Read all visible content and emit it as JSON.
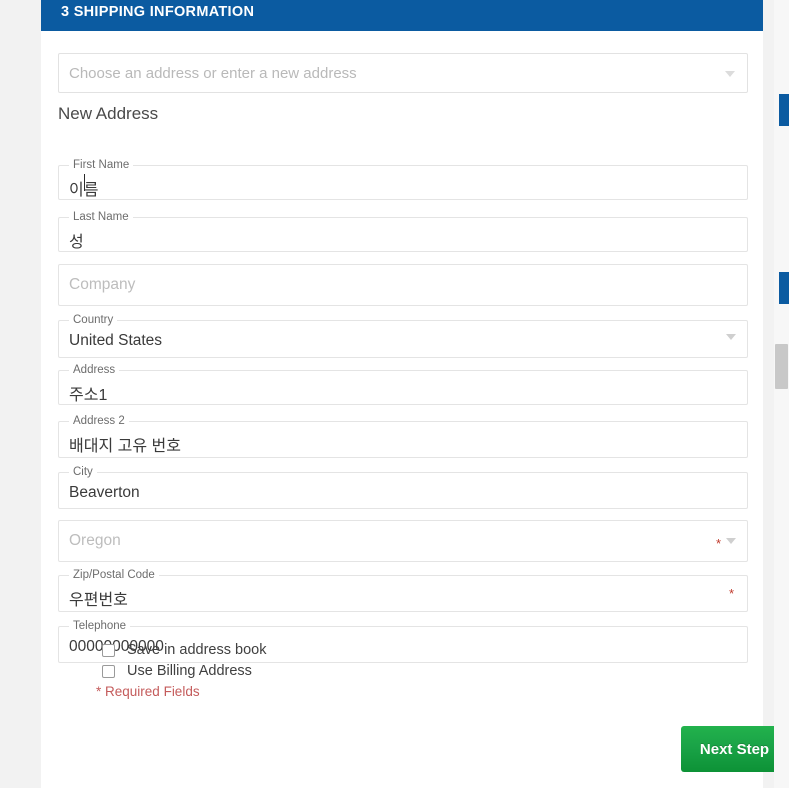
{
  "section": {
    "step_number": "3",
    "title": "3 SHIPPING INFORMATION",
    "header_color": "#0b5ba1"
  },
  "address_select": {
    "placeholder": "Choose an address or enter a new address",
    "value": "",
    "caret_icon": "chevron-down-icon"
  },
  "new_address_heading": "New Address",
  "fields": [
    {
      "name": "first-name",
      "label": "First Name",
      "value": "이름",
      "placeholder": "",
      "has_label": true,
      "required": false,
      "is_select": false,
      "korean": true
    },
    {
      "name": "last-name",
      "label": "Last Name",
      "value": "성",
      "placeholder": "",
      "has_label": true,
      "required": false,
      "is_select": false,
      "korean": true
    },
    {
      "name": "company",
      "label": "",
      "value": "",
      "placeholder": "Company",
      "has_label": false,
      "required": false,
      "is_select": false,
      "korean": false
    },
    {
      "name": "country",
      "label": "Country",
      "value": "United States",
      "placeholder": "",
      "has_label": true,
      "required": false,
      "is_select": true,
      "korean": false
    },
    {
      "name": "address",
      "label": "Address",
      "value": "주소1",
      "placeholder": "",
      "has_label": true,
      "required": false,
      "is_select": false,
      "korean": true
    },
    {
      "name": "address-2",
      "label": "Address 2",
      "value": "배대지 고유 번호",
      "placeholder": "",
      "has_label": true,
      "required": false,
      "is_select": false,
      "korean": true
    },
    {
      "name": "city",
      "label": "City",
      "value": "Beaverton",
      "placeholder": "",
      "has_label": true,
      "required": false,
      "is_select": false,
      "korean": false
    },
    {
      "name": "state",
      "label": "",
      "value": "",
      "placeholder": "Oregon",
      "has_label": false,
      "required": true,
      "is_select": true,
      "korean": false
    },
    {
      "name": "zip-postal-code",
      "label": "Zip/Postal Code",
      "value": "우편번호",
      "placeholder": "",
      "has_label": true,
      "required": true,
      "is_select": false,
      "korean": true
    },
    {
      "name": "telephone",
      "label": "Telephone",
      "value": "00000000000",
      "placeholder": "",
      "has_label": true,
      "required": false,
      "is_select": false,
      "korean": false
    }
  ],
  "checkboxes": [
    {
      "name": "save-in-address-book",
      "label": "Save in address book",
      "checked": false
    },
    {
      "name": "use-billing-address",
      "label": "Use Billing Address",
      "checked": false
    }
  ],
  "required_note": {
    "star": "*",
    "text": "Required Fields",
    "color": "#c45b5b"
  },
  "next_step_button": {
    "label": "Next Step",
    "color": "#1aa347"
  },
  "required_marker": "*"
}
